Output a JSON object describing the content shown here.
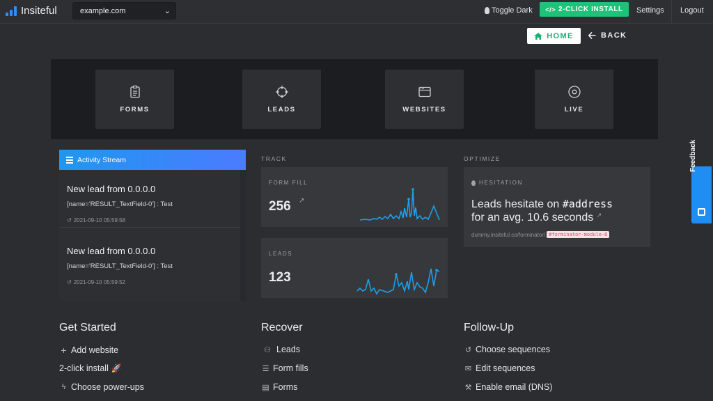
{
  "nav": {
    "brand": "Insiteful",
    "site_select": "example.com",
    "toggle_dark": "Toggle Dark",
    "install_label": "2-CLICK INSTALL",
    "settings": "Settings",
    "logout": "Logout"
  },
  "subnav": {
    "home": "HOME",
    "back": "BACK"
  },
  "tiles": [
    {
      "label": "FORMS",
      "icon": "clipboard-icon"
    },
    {
      "label": "LEADS",
      "icon": "crosshair-icon"
    },
    {
      "label": "WEBSITES",
      "icon": "browser-window-icon"
    },
    {
      "label": "LIVE",
      "icon": "target-circle-icon"
    }
  ],
  "activity": {
    "title": "Activity Stream",
    "items": [
      {
        "title": "New lead from 0.0.0.0",
        "detail": "[name='RESULT_TextField-0'] : Test",
        "time": "2021-09-10 05:59:58"
      },
      {
        "title": "New lead from 0.0.0.0",
        "detail": "[name='RESULT_TextField-0'] : Test",
        "time": "2021-09-10 05:59:52"
      }
    ]
  },
  "track": {
    "label": "TRACK",
    "form_fill": {
      "label": "FORM FILL",
      "value": "256"
    },
    "leads": {
      "label": "LEADS",
      "value": "123"
    }
  },
  "optimize": {
    "label": "OPTIMIZE",
    "card_label": "HESITATION",
    "line1_prefix": "Leads hesitate on",
    "field": "#address",
    "line2": "for an avg. 10.6 seconds",
    "url": "dummy.insiteful.co/forminator/",
    "tag": "#forminator-module-6"
  },
  "feedback": {
    "label": "Feedback"
  },
  "columns": {
    "get_started": {
      "title": "Get Started",
      "items": [
        "Add website",
        "2-click install",
        "Choose power-ups"
      ]
    },
    "recover": {
      "title": "Recover",
      "items": [
        "Leads",
        "Form fills",
        "Forms"
      ]
    },
    "follow_up": {
      "title": "Follow-Up",
      "items": [
        "Choose sequences",
        "Edit sequences",
        "Enable email (DNS)"
      ]
    }
  },
  "colors": {
    "accent_green": "#1ec37a",
    "accent_blue": "#1f8ef2",
    "sparkline": "#1e9fe8",
    "background": "#2b2d30"
  }
}
